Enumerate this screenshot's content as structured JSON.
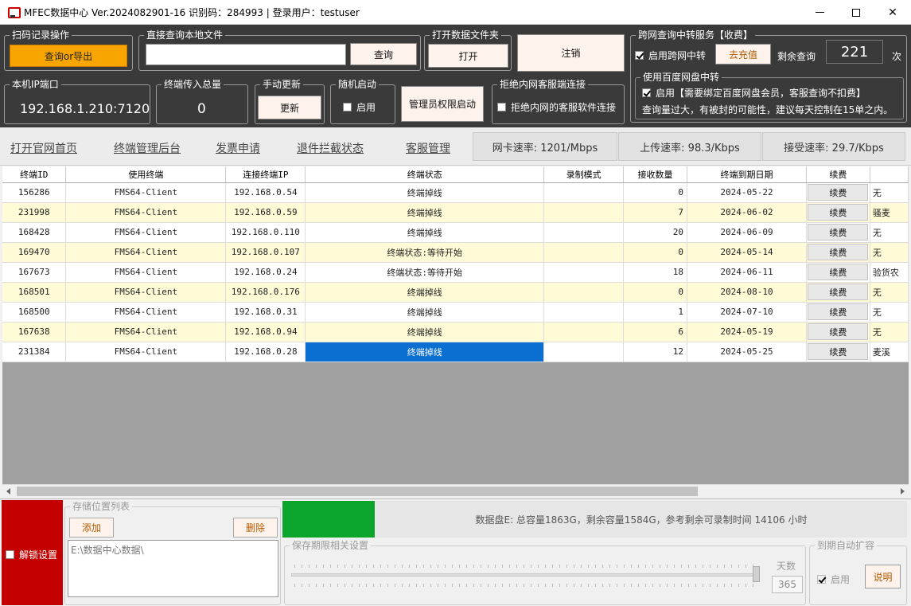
{
  "window": {
    "title": "MFEC数据中心 Ver.2024082901-16 识别码：284993 | 登录用户：testuser"
  },
  "scan": {
    "legend": "扫码记录操作",
    "button": "查询or导出"
  },
  "local_query": {
    "legend": "直接查询本地文件",
    "value": "",
    "button": "查询"
  },
  "open_folder": {
    "legend": "打开数据文件夹",
    "button": "打开"
  },
  "logout": {
    "button": "注销"
  },
  "relay": {
    "legend": "跨网查询中转服务【收费】",
    "enable_label": "启用跨网中转",
    "enable_checked": true,
    "recharge_button": "去充值",
    "remaining_label": "剩余查询",
    "remaining_count": "221",
    "unit": "次"
  },
  "baidu": {
    "legend": "使用百度网盘中转",
    "enable_label": "启用【需要绑定百度网盘会员，客服查询不扣费】",
    "enable_checked": true,
    "note": "查询量过大，有被封的可能性，建议每天控制在15单之内。"
  },
  "ip_port": {
    "legend": "本机IP端口",
    "value": "192.168.1.210:7120"
  },
  "total_upload": {
    "legend": "终端传入总量",
    "value": "0"
  },
  "manual_update": {
    "legend": "手动更新",
    "button": "更新"
  },
  "random_start": {
    "legend": "随机启动",
    "label": "启用",
    "checked": false
  },
  "admin": {
    "button": "管理员权限启动"
  },
  "reject_lan": {
    "legend": "拒绝内网客服端连接",
    "label": "拒绝内网的客服软件连接",
    "checked": false
  },
  "nav": {
    "links": [
      "打开官网首页",
      "终端管理后台",
      "发票申请",
      "退件拦截状态",
      "客服管理"
    ],
    "nic_speed": "网卡速率: 1201/Mbps",
    "upload_speed": "上传速率: 98.3/Kbps",
    "receive_speed": "接受速率: 29.7/Kbps"
  },
  "table": {
    "columns": [
      "终端ID",
      "使用终端",
      "连接终端IP",
      "终端状态",
      "录制模式",
      "接收数量",
      "终端到期日期",
      "续费",
      ""
    ],
    "renew_label": "续费",
    "rows": [
      {
        "id": "156286",
        "client": "FMS64-Client",
        "ip": "192.168.0.54",
        "status": "终端掉线",
        "mode": "",
        "count": "0",
        "expiry": "2024-05-22",
        "note": "无"
      },
      {
        "id": "231998",
        "client": "FMS64-Client",
        "ip": "192.168.0.59",
        "status": "终端掉线",
        "mode": "",
        "count": "7",
        "expiry": "2024-06-02",
        "note": "骚麦"
      },
      {
        "id": "168428",
        "client": "FMS64-Client",
        "ip": "192.168.0.110",
        "status": "终端掉线",
        "mode": "",
        "count": "20",
        "expiry": "2024-06-09",
        "note": "无"
      },
      {
        "id": "169470",
        "client": "FMS64-Client",
        "ip": "192.168.0.107",
        "status": "终端状态:等待开始",
        "mode": "",
        "count": "0",
        "expiry": "2024-05-14",
        "note": "无"
      },
      {
        "id": "167673",
        "client": "FMS64-Client",
        "ip": "192.168.0.24",
        "status": "终端状态:等待开始",
        "mode": "",
        "count": "18",
        "expiry": "2024-06-11",
        "note": "验货农"
      },
      {
        "id": "168501",
        "client": "FMS64-Client",
        "ip": "192.168.0.176",
        "status": "终端掉线",
        "mode": "",
        "count": "0",
        "expiry": "2024-08-10",
        "note": "无"
      },
      {
        "id": "168500",
        "client": "FMS64-Client",
        "ip": "192.168.0.31",
        "status": "终端掉线",
        "mode": "",
        "count": "1",
        "expiry": "2024-07-10",
        "note": "无"
      },
      {
        "id": "167638",
        "client": "FMS64-Client",
        "ip": "192.168.0.94",
        "status": "终端掉线",
        "mode": "",
        "count": "6",
        "expiry": "2024-05-19",
        "note": "无"
      },
      {
        "id": "231384",
        "client": "FMS64-Client",
        "ip": "192.168.0.28",
        "status": "终端掉线",
        "mode": "",
        "count": "12",
        "expiry": "2024-05-25",
        "note": "麦溪",
        "selected": true
      }
    ]
  },
  "bottom": {
    "unlock_label": "解锁设置",
    "storage_legend": "存储位置列表",
    "add_button": "添加",
    "delete_button": "删除",
    "storage_path": "E:\\数据中心数据\\",
    "disk_info": "数据盘E: 总容量1863G，剩余容量1584G，参考剩余可录制时间 14106 小时",
    "retention_legend": "保存期限相关设置",
    "days_label": "天数",
    "days_value": "365",
    "auto_extend_legend": "到期自动扩容",
    "auto_extend_label": "启用",
    "auto_extend_checked": true,
    "help_button": "说明"
  },
  "colors": {
    "accent_orange": "#f8a500",
    "selected_blue": "#0a6fd0",
    "danger_red": "#c40000",
    "disk_green": "#0aa52a"
  }
}
